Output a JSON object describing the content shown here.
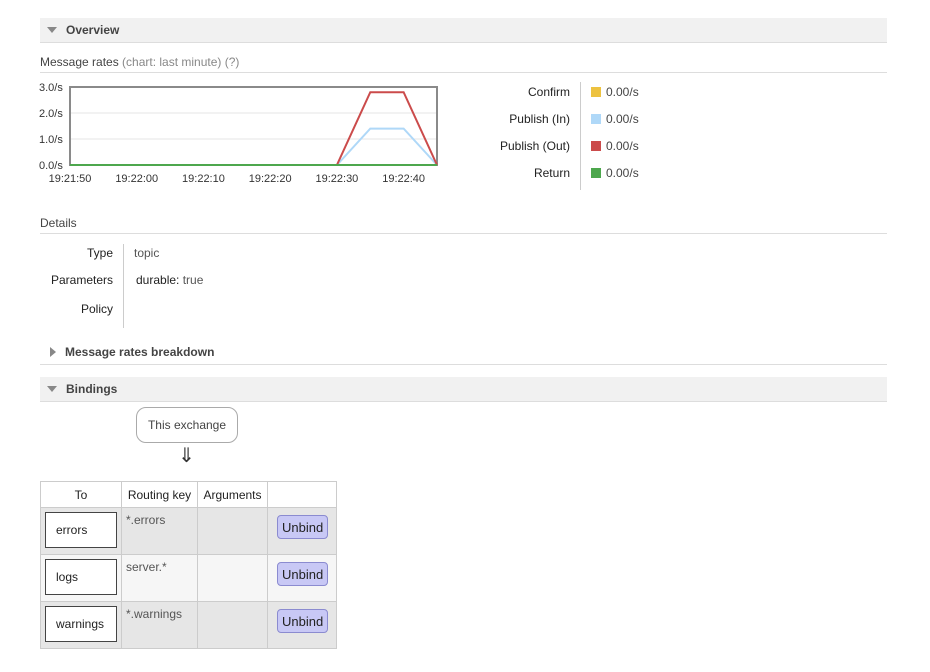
{
  "overview": {
    "title": "Overview"
  },
  "message_rates": {
    "label": "Message rates",
    "note": "(chart: last minute) (?)"
  },
  "chart_data": {
    "type": "line",
    "y_ticks": [
      "3.0/s",
      "2.0/s",
      "1.0/s",
      "0.0/s"
    ],
    "ylim": [
      0,
      3
    ],
    "x_ticks": [
      "19:21:50",
      "19:22:00",
      "19:22:10",
      "19:22:20",
      "19:22:30",
      "19:22:40"
    ],
    "x": [
      0,
      40,
      45,
      50,
      55
    ],
    "series": [
      {
        "name": "Confirm",
        "color": "#edc240",
        "values": [
          0,
          0,
          0,
          0,
          0
        ]
      },
      {
        "name": "Publish (In)",
        "color": "#afd8f8",
        "values": [
          0,
          0,
          1.4,
          1.4,
          0
        ]
      },
      {
        "name": "Publish (Out)",
        "color": "#cb4b4b",
        "values": [
          0,
          0,
          2.8,
          2.8,
          0
        ]
      },
      {
        "name": "Return",
        "color": "#4da74d",
        "values": [
          0,
          0,
          0,
          0,
          0
        ]
      }
    ],
    "legend_values": [
      "0.00/s",
      "0.00/s",
      "0.00/s",
      "0.00/s"
    ]
  },
  "details": {
    "title": "Details",
    "type_label": "Type",
    "type_value": "topic",
    "params_label": "Parameters",
    "params_key": "durable:",
    "params_value": "true",
    "policy_label": "Policy"
  },
  "breakdown": {
    "title": "Message rates breakdown"
  },
  "bindings": {
    "title": "Bindings",
    "this_exchange": "This exchange",
    "arrow": "⇓",
    "headers": [
      "To",
      "Routing key",
      "Arguments",
      ""
    ],
    "rows": [
      {
        "to": "errors",
        "routing_key": "*.errors",
        "arguments": "",
        "action": "Unbind"
      },
      {
        "to": "logs",
        "routing_key": "server.*",
        "arguments": "",
        "action": "Unbind"
      },
      {
        "to": "warnings",
        "routing_key": "*.warnings",
        "arguments": "",
        "action": "Unbind"
      }
    ]
  }
}
